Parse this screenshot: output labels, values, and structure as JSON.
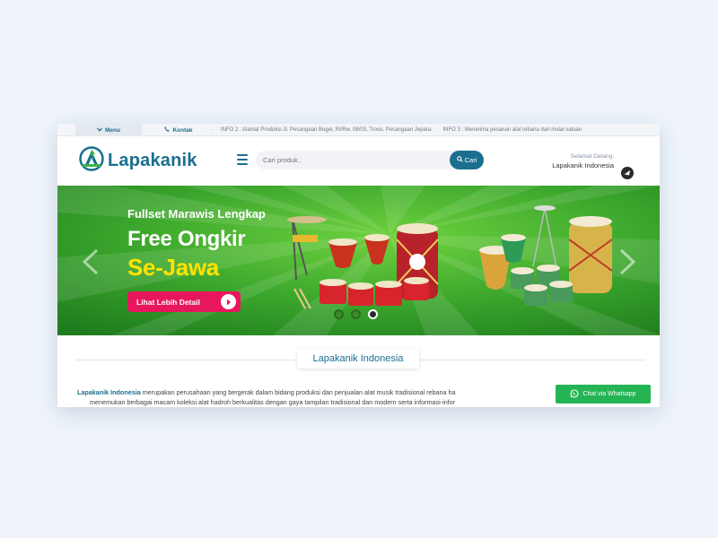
{
  "topbar": {
    "menu_label": "Menu",
    "kontak_label": "Kontak",
    "separator": "-",
    "info2": "INFO 2 : Alamat Produksi Jl. Pecangaan Bugel, Rt/Rw. 08/03, Troso, Pecangaan Jepara.",
    "info3": "INFO 3 : Menerima pesanan alat rebana dari mulai satuan"
  },
  "header": {
    "logo_text": "Lapakanik",
    "search_placeholder": "Cari produk..",
    "search_button": "Cari",
    "welcome_line1": "Selamat Datang,",
    "welcome_line2": "Lapakanik Indonesia"
  },
  "banner": {
    "title": "Fullset Marawis Lengkap",
    "headline1": "Free Ongkir",
    "headline2": "Se-Jawa",
    "cta_label": "Lihat Lebih Detail",
    "active_slide": 3,
    "slide_count": 3
  },
  "content": {
    "section_title": "Lapakanik Indonesia",
    "para_brand": "Lapakanik Indonesia",
    "para_line1": " merupakan perusahaan yang bergerak dalam bidang produksi dan penjualan alat musik tradisional rebana ha",
    "para_line2": "menemukan berbagai macam koleksi alat hadroh berkualitas dengan gaya tampilan tradisional dan modern serta informasi-infor"
  },
  "whatsapp": {
    "label": "Chat via Whatsapp"
  },
  "colors": {
    "brand": "#1a6f8f",
    "banner_green": "#3aa52c",
    "cta_pink": "#e8175d",
    "headline_yellow": "#ffe400",
    "whatsapp_green": "#25b454"
  }
}
